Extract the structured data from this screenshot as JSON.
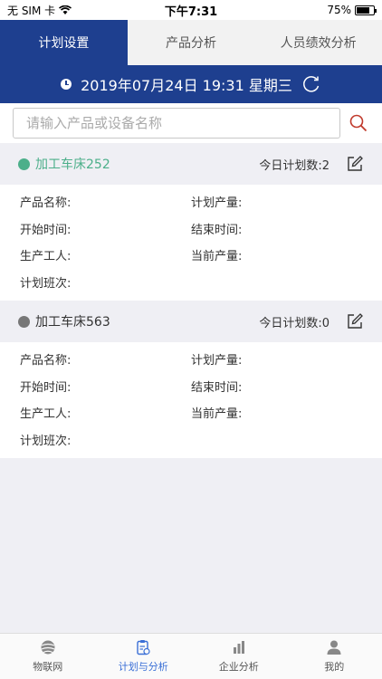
{
  "status": {
    "carrier": "无 SIM 卡",
    "time": "下午7:31",
    "battery": "75%",
    "battery_level": 0.75
  },
  "tabs": [
    {
      "label": "计划设置",
      "active": true
    },
    {
      "label": "产品分析",
      "active": false
    },
    {
      "label": "人员绩效分析",
      "active": false
    }
  ],
  "datebar": {
    "datetime": "2019年07月24日 19:31 星期三"
  },
  "search": {
    "placeholder": "请输入产品或设备名称",
    "value": ""
  },
  "devices": [
    {
      "name": "加工车床252",
      "status_color": "#4caf8a",
      "name_color": "#4caf8a",
      "count_label": "今日计划数:2",
      "fields": {
        "product": "产品名称:",
        "plan_output": "计划产量:",
        "start": "开始时间:",
        "end": "结束时间:",
        "worker": "生产工人:",
        "current_output": "当前产量:",
        "shift": "计划班次:"
      }
    },
    {
      "name": "加工车床563",
      "status_color": "#777777",
      "name_color": "#333333",
      "count_label": "今日计划数:0",
      "fields": {
        "product": "产品名称:",
        "plan_output": "计划产量:",
        "start": "开始时间:",
        "end": "结束时间:",
        "worker": "生产工人:",
        "current_output": "当前产量:",
        "shift": "计划班次:"
      }
    }
  ],
  "bottom_nav": [
    {
      "label": "物联网",
      "icon": "globe-icon",
      "active": false
    },
    {
      "label": "计划与分析",
      "icon": "clipboard-icon",
      "active": true
    },
    {
      "label": "企业分析",
      "icon": "bar-chart-icon",
      "active": false
    },
    {
      "label": "我的",
      "icon": "person-icon",
      "active": false
    }
  ],
  "colors": {
    "primary": "#1e3f8f",
    "accent": "#3a6fd6",
    "search_icon": "#c0392b"
  }
}
